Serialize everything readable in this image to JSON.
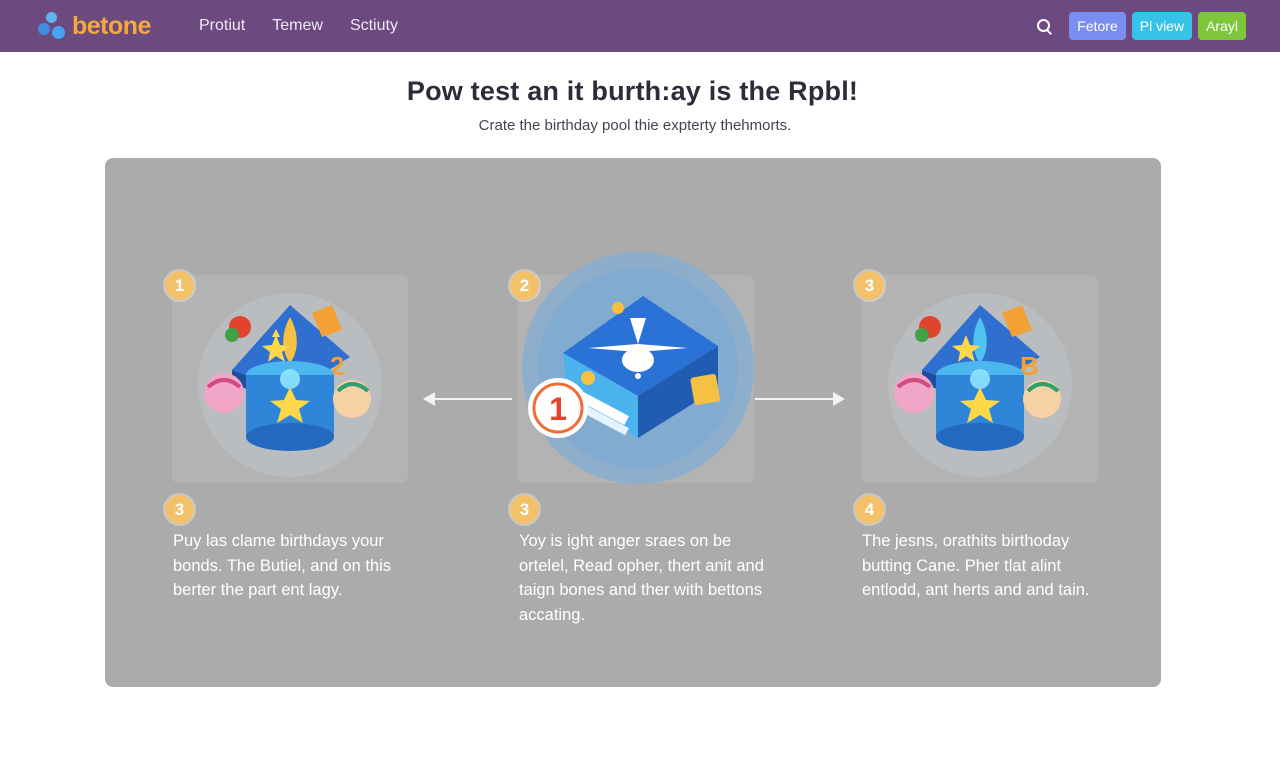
{
  "brand": {
    "name": "betone"
  },
  "nav": {
    "items": [
      "Protiut",
      "Temew",
      "Sctiuty"
    ]
  },
  "actions": {
    "buttons": [
      "Fetore",
      "Pl view",
      "Arayl"
    ]
  },
  "hero": {
    "title": "Pow test an it burth:ay is the Rpbl!",
    "subtitle": "Crate the birthday pool thie expterty thehmorts."
  },
  "steps": [
    {
      "card_badge": "1",
      "text_badge": "3",
      "text": "Puy las clame birthdays your bonds. The Butiel, and on this berter the part ent lagy."
    },
    {
      "card_badge": "2",
      "text_badge": "3",
      "text": "Yoy is ight anger sraes on be ortelel, Read opher, thert anit and taign bones and ther with bettons accating."
    },
    {
      "card_badge": "3",
      "text_badge": "4",
      "text": "The jesns, orathits birthoday butting Cane. Pher tlat alint entlodd, ant herts and and tain."
    }
  ],
  "center_art": {
    "number": "1"
  },
  "colors": {
    "topbar": "#6c4a7f",
    "brand": "#f6a93b",
    "panel": "#ababab",
    "badge": "#f3c16a",
    "button_blue": "#7a8df0",
    "button_cyan": "#36c3e8",
    "button_green": "#7ec63a"
  }
}
